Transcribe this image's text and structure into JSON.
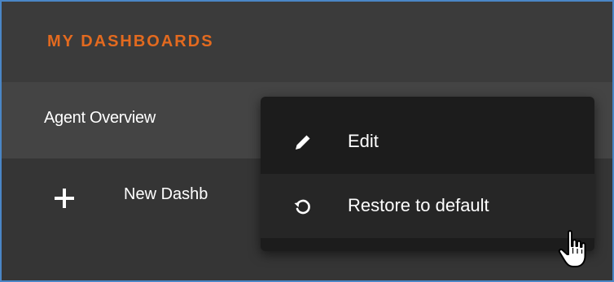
{
  "header": {
    "title": "MY DASHBOARDS"
  },
  "dashboards": {
    "items": [
      {
        "label": "Agent Overview"
      },
      {
        "label": "New Dashb"
      }
    ]
  },
  "context_menu": {
    "items": [
      {
        "label": "Edit",
        "icon": "pencil-icon"
      },
      {
        "label": "Restore to default",
        "icon": "restore-icon"
      }
    ]
  },
  "colors": {
    "accent": "#e36a1f",
    "panel_bg": "#353535",
    "selected_row_bg": "#444444",
    "menu_bg": "#1c1c1c",
    "menu_hover_bg": "#262626",
    "text": "#ffffff"
  },
  "cursor": {
    "icon": "hand-pointer-icon"
  }
}
